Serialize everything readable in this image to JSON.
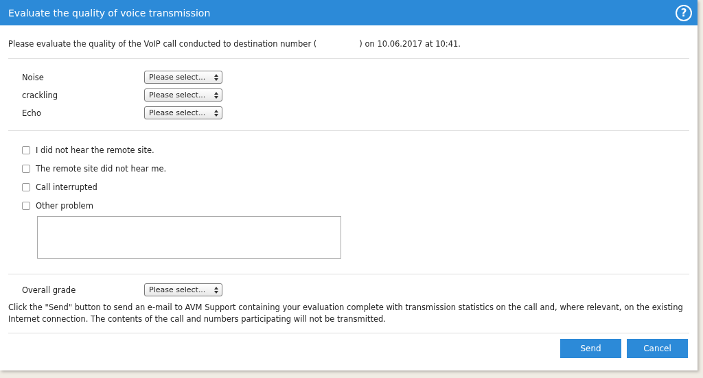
{
  "window": {
    "title": "Evaluate the quality of voice transmission",
    "help": "?"
  },
  "intro": {
    "before": "Please evaluate the quality of the VoIP call conducted to destination number (",
    "after": ") on 10.06.2017 at 10:41."
  },
  "ratings": [
    {
      "label": "Noise",
      "value": "Please select..."
    },
    {
      "label": "crackling",
      "value": "Please select..."
    },
    {
      "label": "Echo",
      "value": "Please select..."
    }
  ],
  "problems": [
    {
      "label": "I did not hear the remote site.",
      "checked": false
    },
    {
      "label": "The remote site did not hear me.",
      "checked": false
    },
    {
      "label": "Call interrupted",
      "checked": false
    },
    {
      "label": "Other problem",
      "checked": false
    }
  ],
  "overall": {
    "label": "Overall grade",
    "value": "Please select..."
  },
  "note": "Click the \"Send\" button to send an e-mail to AVM Support containing your evaluation complete with transmission statistics on the call and, where relevant, on the existing Internet connection. The contents of the call and numbers participating will not be transmitted.",
  "buttons": [
    "Send",
    "Cancel"
  ]
}
